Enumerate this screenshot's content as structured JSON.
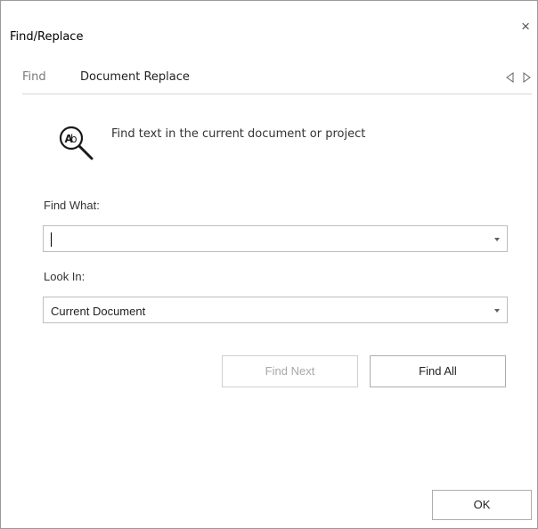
{
  "window": {
    "title": "Find/Replace",
    "close_glyph": "×"
  },
  "tabs": [
    {
      "label": "Find",
      "selected": true
    },
    {
      "label": "Document Replace",
      "selected": false
    }
  ],
  "tab_nav": {
    "prev_icon": "triangle-left-icon",
    "next_icon": "triangle-right-icon"
  },
  "info": {
    "icon": "find-text-magnifier-icon",
    "text": "Find text in the current document or project"
  },
  "find_what": {
    "label": "Find What:",
    "value": ""
  },
  "look_in": {
    "label": "Look In:",
    "value": "Current Document"
  },
  "buttons": {
    "find_next": "Find Next",
    "find_all": "Find All",
    "ok": "OK"
  }
}
